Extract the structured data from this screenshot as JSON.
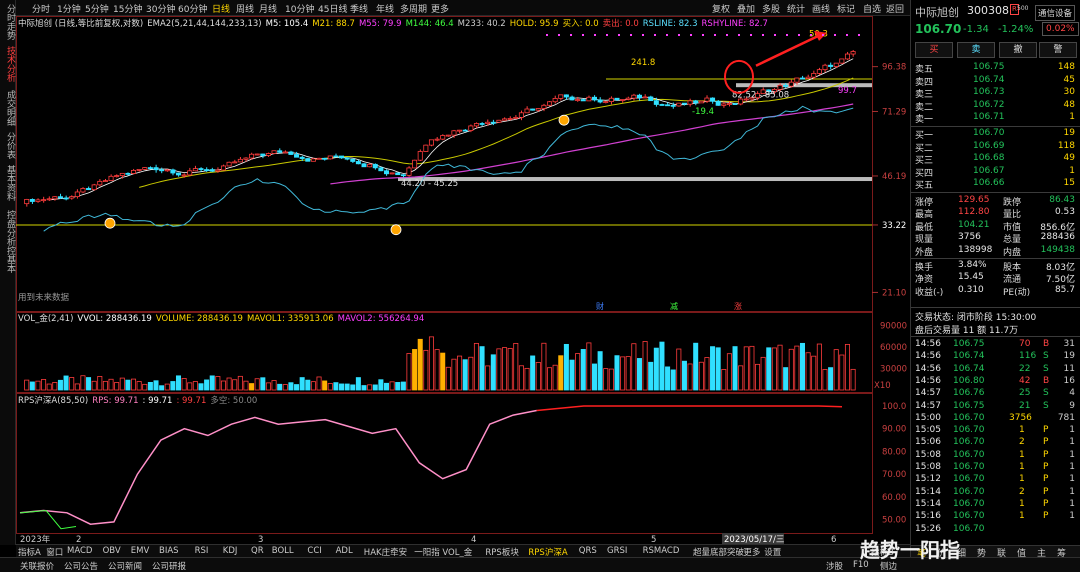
{
  "toolbar": {
    "periods": [
      "分时",
      "1分钟",
      "5分钟",
      "15分钟",
      "30分钟",
      "60分钟",
      "日线",
      "周线",
      "月线",
      "10分钟",
      "45日线",
      "季线",
      "年线",
      "多周期",
      "更多"
    ],
    "active_period": "日线",
    "tools": [
      "复权",
      "叠加",
      "多股",
      "统计",
      "画线",
      "标记",
      "自选",
      "返回"
    ]
  },
  "left_tabs": [
    "分时走势",
    "技术分析",
    "成交明细",
    "分价表",
    "基本资料",
    "控盘分析",
    "控基本"
  ],
  "legend": {
    "main_title": "中际旭创 (日线,等比前复权,对数)",
    "ema": "EMA2(5,21,44,144,233,13)",
    "items": [
      {
        "t": "M5: 105.4",
        "c": "#ffffff"
      },
      {
        "t": "M21: 88.7",
        "c": "#ffd700"
      },
      {
        "t": "M55: 79.9",
        "c": "#ff40ff"
      },
      {
        "t": "M144: 46.4",
        "c": "#40ff40"
      },
      {
        "t": "M233: 40.2",
        "c": "#cccccc"
      },
      {
        "t": "HOLD: 95.9",
        "c": "#ffd700"
      },
      {
        "t": "卖出",
        "c": "#ff4040"
      },
      {
        "t": "买入: 0.0",
        "c": "#ffd700"
      },
      {
        "t": "卖出: 0.0",
        "c": "#ff4040"
      },
      {
        "t": "RSLINE: 82.3",
        "c": "#5ce0ff"
      },
      {
        "t": "RSHYLINE: 82.7",
        "c": "#ff40ff"
      }
    ],
    "vol_title": "VOL_金(2,41)",
    "vol_items": [
      {
        "t": "VVOL: 288436.19",
        "c": "#ffffff"
      },
      {
        "t": "VOLUME: 288436.19",
        "c": "#ffd700"
      },
      {
        "t": "MAVOL1: 335913.06",
        "c": "#ffd700"
      },
      {
        "t": "MAVOL2: 556264.94",
        "c": "#ff40ff"
      }
    ],
    "rps_title": "RPS沪深A(85,50)",
    "rps_items": [
      {
        "t": "RPS: 99.71",
        "c": "#ff80c0"
      },
      {
        "t": ": 99.71",
        "c": "#ffffff"
      },
      {
        "t": ": 99.71",
        "c": "#ff4040"
      },
      {
        "t": "多空: 50.00",
        "c": "#888888"
      }
    ]
  },
  "annotations": {
    "price_241": "241.8",
    "price_50": "50.3",
    "range1": "82.52 - 85.08",
    "range2": "44.20 - 45.25",
    "low": "-19.4",
    "label_997": "99.7",
    "future": "用到未来数据",
    "fin": "财",
    "fin2": "减",
    "fin3": "涨"
  },
  "axis": {
    "main_ticks": [
      "96.38",
      "71.29",
      "46.19",
      "33.22",
      "21.10"
    ],
    "vol_ticks": [
      "90000",
      "60000",
      "30000"
    ],
    "vol_unit": "X10",
    "rps_ticks": [
      "100.0",
      "90.00",
      "80.00",
      "70.00",
      "60.00",
      "50.00"
    ],
    "x_labels": [
      "2023年",
      "2",
      "3",
      "4",
      "5",
      "6"
    ],
    "date_cursor": "2023/05/17/三"
  },
  "chart_data": {
    "type": "candlestick",
    "series": [
      {
        "name": "M5",
        "values": []
      },
      {
        "name": "RPS",
        "values": [
          53,
          54,
          53,
          48,
          49,
          70,
          85,
          90,
          87,
          92,
          95,
          92,
          93,
          94,
          91,
          88,
          90,
          75,
          68,
          72,
          92,
          96,
          98,
          99,
          100,
          100,
          100,
          100,
          100,
          100,
          100,
          100,
          100,
          100,
          100,
          99.71
        ]
      }
    ]
  },
  "right": {
    "name": "中际旭创",
    "code": "300308",
    "r_badge": "R",
    "r_num": "500",
    "setting": "通信设备",
    "price": "106.70",
    "change": "-1.34",
    "pct": "-1.24%",
    "ratio": "0.02%",
    "buttons": [
      "买",
      "卖",
      "撤",
      "警"
    ],
    "asks": [
      {
        "l": "卖五",
        "p": "106.75",
        "v": "148"
      },
      {
        "l": "卖四",
        "p": "106.74",
        "v": "45"
      },
      {
        "l": "卖三",
        "p": "106.73",
        "v": "30"
      },
      {
        "l": "卖二",
        "p": "106.72",
        "v": "48"
      },
      {
        "l": "卖一",
        "p": "106.71",
        "v": "1"
      }
    ],
    "bids": [
      {
        "l": "买一",
        "p": "106.70",
        "v": "19"
      },
      {
        "l": "买二",
        "p": "106.69",
        "v": "118"
      },
      {
        "l": "买三",
        "p": "106.68",
        "v": "49"
      },
      {
        "l": "买四",
        "p": "106.67",
        "v": "1"
      },
      {
        "l": "买五",
        "p": "106.66",
        "v": "15"
      }
    ],
    "stats": [
      {
        "a": "涨停",
        "b": "129.65",
        "c": "跌停",
        "d": "86.43"
      },
      {
        "a": "最高",
        "b": "112.80",
        "c": "量比",
        "d": "0.53"
      },
      {
        "a": "最低",
        "b": "104.21",
        "c": "市值",
        "d": "856.6亿"
      },
      {
        "a": "现量",
        "b": "3756",
        "c": "总量",
        "d": "288436"
      },
      {
        "a": "外盘",
        "b": "138998",
        "c": "内盘",
        "d": "149438"
      },
      {
        "a": "换手",
        "b": "3.84%",
        "c": "股本",
        "d": "8.03亿"
      },
      {
        "a": "净资",
        "b": "15.45",
        "c": "流通",
        "d": "7.50亿"
      },
      {
        "a": "收益(-)",
        "b": "0.310",
        "c": "PE(动)",
        "d": "85.7"
      }
    ],
    "trade_status": "交易状态: 闭市阶段 15:30:00",
    "after_vol": "盘后交易量 11 额 11.7万",
    "ticks": [
      {
        "t": "14:56",
        "p": "106.75",
        "v": "70",
        "s": "B",
        "n": "31"
      },
      {
        "t": "14:56",
        "p": "106.74",
        "v": "116",
        "s": "S",
        "n": "19"
      },
      {
        "t": "14:56",
        "p": "106.74",
        "v": "22",
        "s": "S",
        "n": "11"
      },
      {
        "t": "14:56",
        "p": "106.80",
        "v": "42",
        "s": "B",
        "n": "16"
      },
      {
        "t": "14:57",
        "p": "106.76",
        "v": "25",
        "s": "S",
        "n": "4"
      },
      {
        "t": "14:57",
        "p": "106.75",
        "v": "21",
        "s": "S",
        "n": "9"
      },
      {
        "t": "15:00",
        "p": "106.70",
        "v": "3756",
        "s": "",
        "n": "781"
      },
      {
        "t": "15:05",
        "p": "106.70",
        "v": "1",
        "s": "P",
        "n": "1"
      },
      {
        "t": "15:06",
        "p": "106.70",
        "v": "2",
        "s": "P",
        "n": "1"
      },
      {
        "t": "15:08",
        "p": "106.70",
        "v": "1",
        "s": "P",
        "n": "1"
      },
      {
        "t": "15:08",
        "p": "106.70",
        "v": "1",
        "s": "P",
        "n": "1"
      },
      {
        "t": "15:12",
        "p": "106.70",
        "v": "1",
        "s": "P",
        "n": "1"
      },
      {
        "t": "15:14",
        "p": "106.70",
        "v": "2",
        "s": "P",
        "n": "1"
      },
      {
        "t": "15:14",
        "p": "106.70",
        "v": "1",
        "s": "P",
        "n": "1"
      },
      {
        "t": "15:16",
        "p": "106.70",
        "v": "1",
        "s": "P",
        "n": "1"
      },
      {
        "t": "15:26",
        "p": "106.70",
        "v": "",
        "s": "",
        "n": ""
      }
    ],
    "bottom_tabs": [
      "笔",
      "价",
      "细",
      "势",
      "联",
      "值",
      "主",
      "筹"
    ]
  },
  "indicators": [
    "指标A",
    "窗口",
    "MACD",
    "OBV",
    "EMV",
    "BIAS",
    "RSI",
    "KDJ",
    "QR",
    "BOLL",
    "CCI",
    "ADL",
    "HAK庄牵安",
    "一阳指",
    "VOL_金",
    "RPS板块",
    "RPS沪深A",
    "QRS",
    "GRSI",
    "RSMACD",
    "超量底部突破",
    "更多",
    "设置"
  ],
  "indicator_right": "指标B",
  "status": [
    "关联报价",
    "公司公告",
    "公司新闻",
    "公司研报"
  ],
  "status_right": [
    "涉股",
    "F10",
    "侧边"
  ],
  "watermark": "趋势一阳指"
}
